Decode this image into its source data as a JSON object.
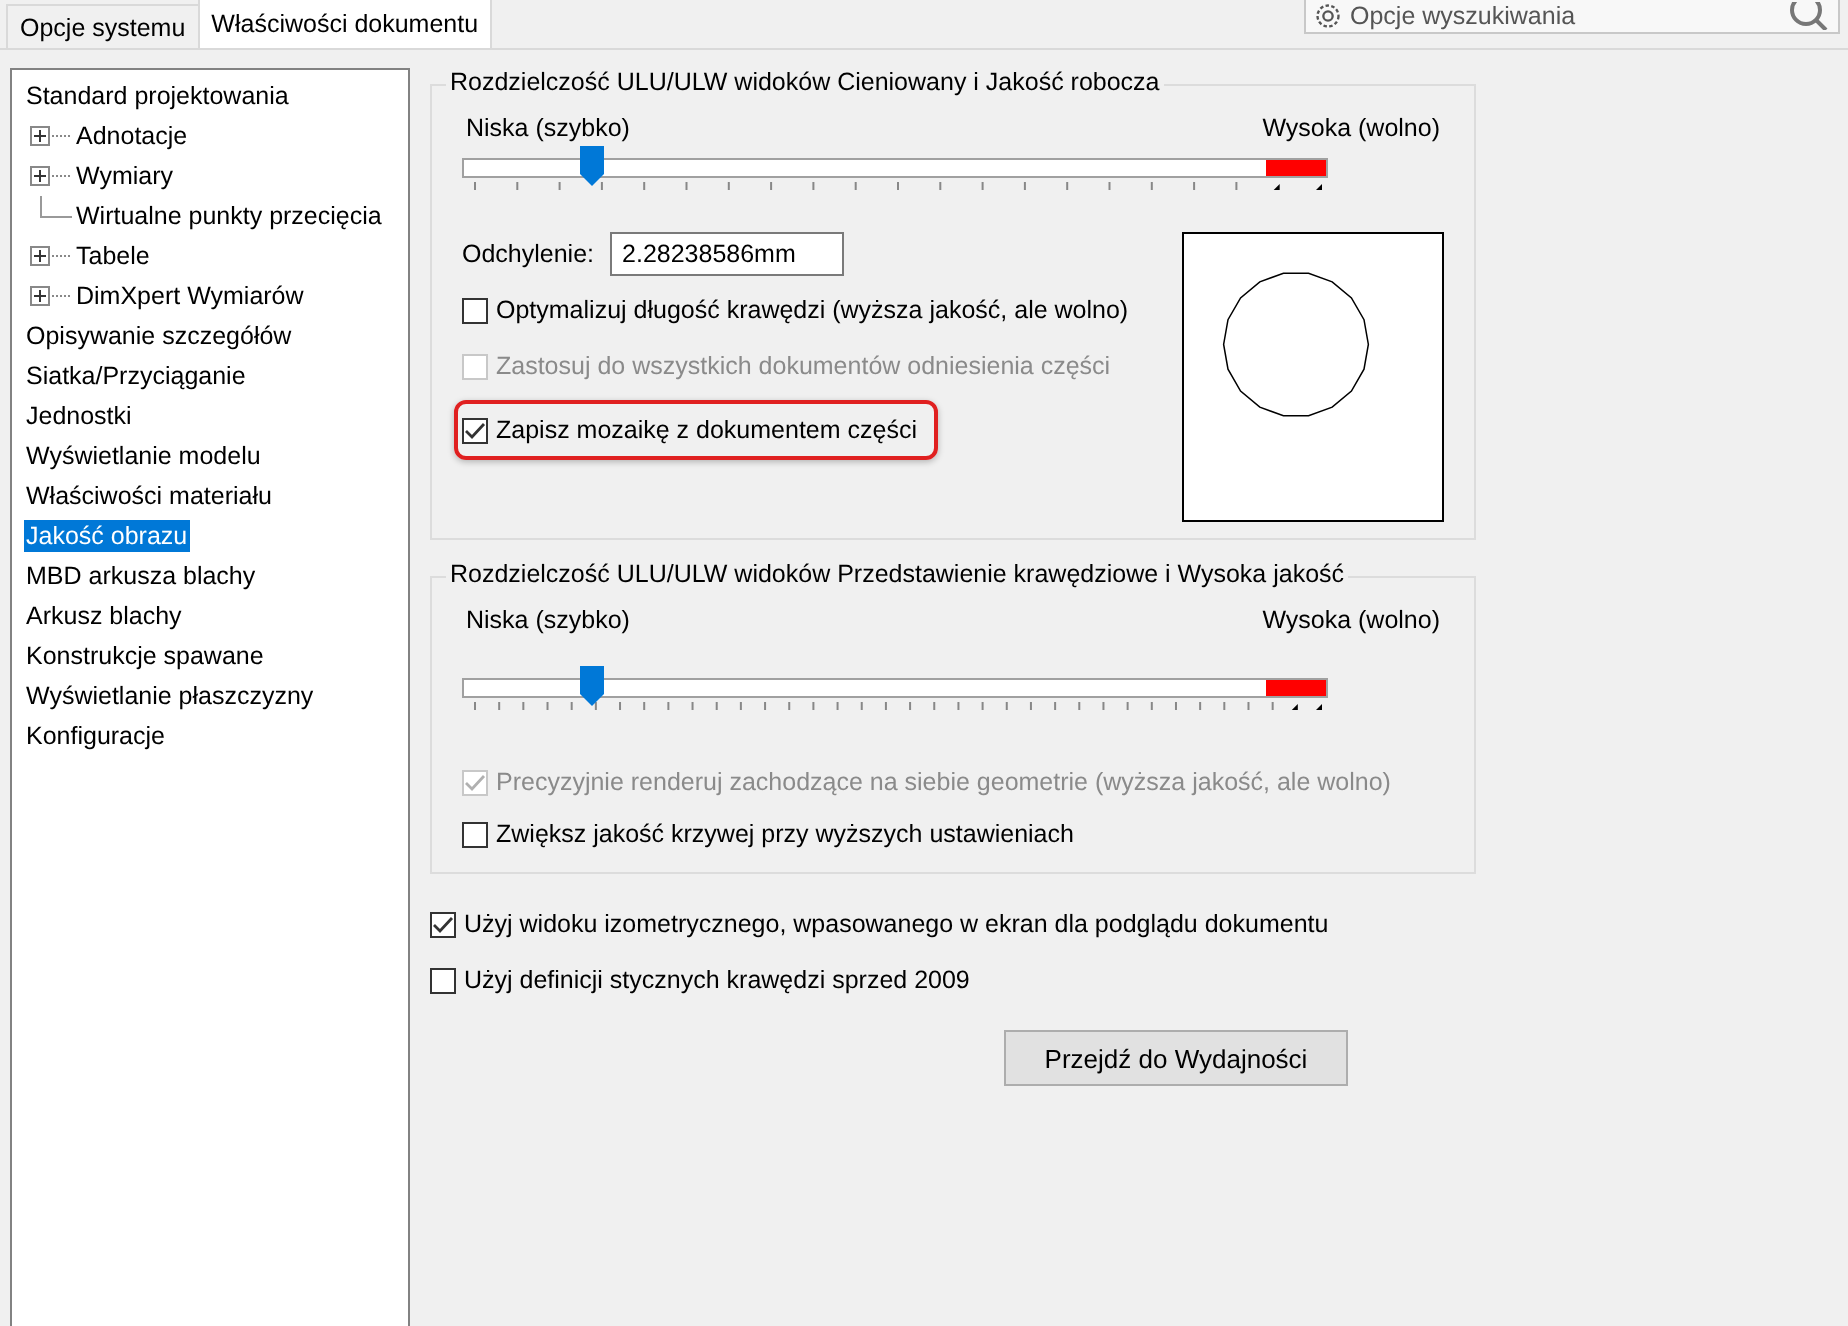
{
  "tabs": [
    {
      "label": "Opcje systemu",
      "selected": false
    },
    {
      "label": "Właściwości dokumentu",
      "selected": true
    }
  ],
  "search": {
    "placeholder": "Opcje wyszukiwania"
  },
  "tree": [
    {
      "label": "Standard projektowania",
      "selected": false,
      "children": [
        {
          "label": "Adnotacje",
          "selected": false,
          "expanded": false
        },
        {
          "label": "Wymiary",
          "selected": false,
          "expanded": false
        },
        {
          "label": "Wirtualne punkty przecięcia",
          "selected": false
        },
        {
          "label": "Tabele",
          "selected": false,
          "expanded": false
        },
        {
          "label": "DimXpert Wymiarów",
          "selected": false,
          "expanded": false
        }
      ]
    },
    {
      "label": "Opisywanie szczegółów",
      "selected": false
    },
    {
      "label": "Siatka/Przyciąganie",
      "selected": false
    },
    {
      "label": "Jednostki",
      "selected": false
    },
    {
      "label": "Wyświetlanie modelu",
      "selected": false
    },
    {
      "label": "Właściwości materiału",
      "selected": false
    },
    {
      "label": "Jakość obrazu",
      "selected": true
    },
    {
      "label": "MBD arkusza blachy",
      "selected": false
    },
    {
      "label": "Arkusz blachy",
      "selected": false
    },
    {
      "label": "Konstrukcje spawane",
      "selected": false
    },
    {
      "label": "Wyświetlanie płaszczyzny",
      "selected": false
    },
    {
      "label": "Konfiguracje",
      "selected": false
    }
  ],
  "groups": [
    {
      "title": "Rozdzielczość ULU/ULW widoków Cieniowany i Jakość robocza",
      "low_label": "Niska (szybko)",
      "high_label": "Wysoka (wolno)",
      "level": 0.15,
      "deviation": {
        "label": "Odchylenie:",
        "value": "2.28238586mm"
      },
      "options": [
        {
          "label": "Optymalizuj długość krawędzi (wyższa jakość, ale wolno)",
          "checked": false,
          "disabled": false,
          "highlighted": false
        },
        {
          "label": "Zastosuj do wszystkich dokumentów odniesienia części",
          "checked": false,
          "disabled": true,
          "highlighted": false
        },
        {
          "label": "Zapisz mozaikę z dokumentem części",
          "checked": true,
          "disabled": false,
          "highlighted": true
        }
      ]
    },
    {
      "title": "Rozdzielczość ULU/ULW widoków Przedstawienie krawędziowe i Wysoka jakość",
      "low_label": "Niska (szybko)",
      "high_label": "Wysoka (wolno)",
      "level": 0.15,
      "options": [
        {
          "label": "Precyzyjnie renderuj zachodzące na siebie geometrie (wyższa jakość, ale wolno)",
          "checked": true,
          "disabled": true,
          "highlighted": false
        },
        {
          "label": "Zwiększ jakość krzywej przy wyższych ustawieniach",
          "checked": false,
          "disabled": false,
          "highlighted": false
        }
      ]
    }
  ],
  "options": [
    {
      "label": "Użyj widoku izometrycznego, wpasowanego w ekran dla podglądu dokumentu",
      "checked": true,
      "disabled": false,
      "highlighted": false
    },
    {
      "label": "Użyj definicji stycznych krawędzi sprzed 2009",
      "checked": false,
      "disabled": false,
      "highlighted": false
    }
  ],
  "button": "Przejdź do Wydajności"
}
